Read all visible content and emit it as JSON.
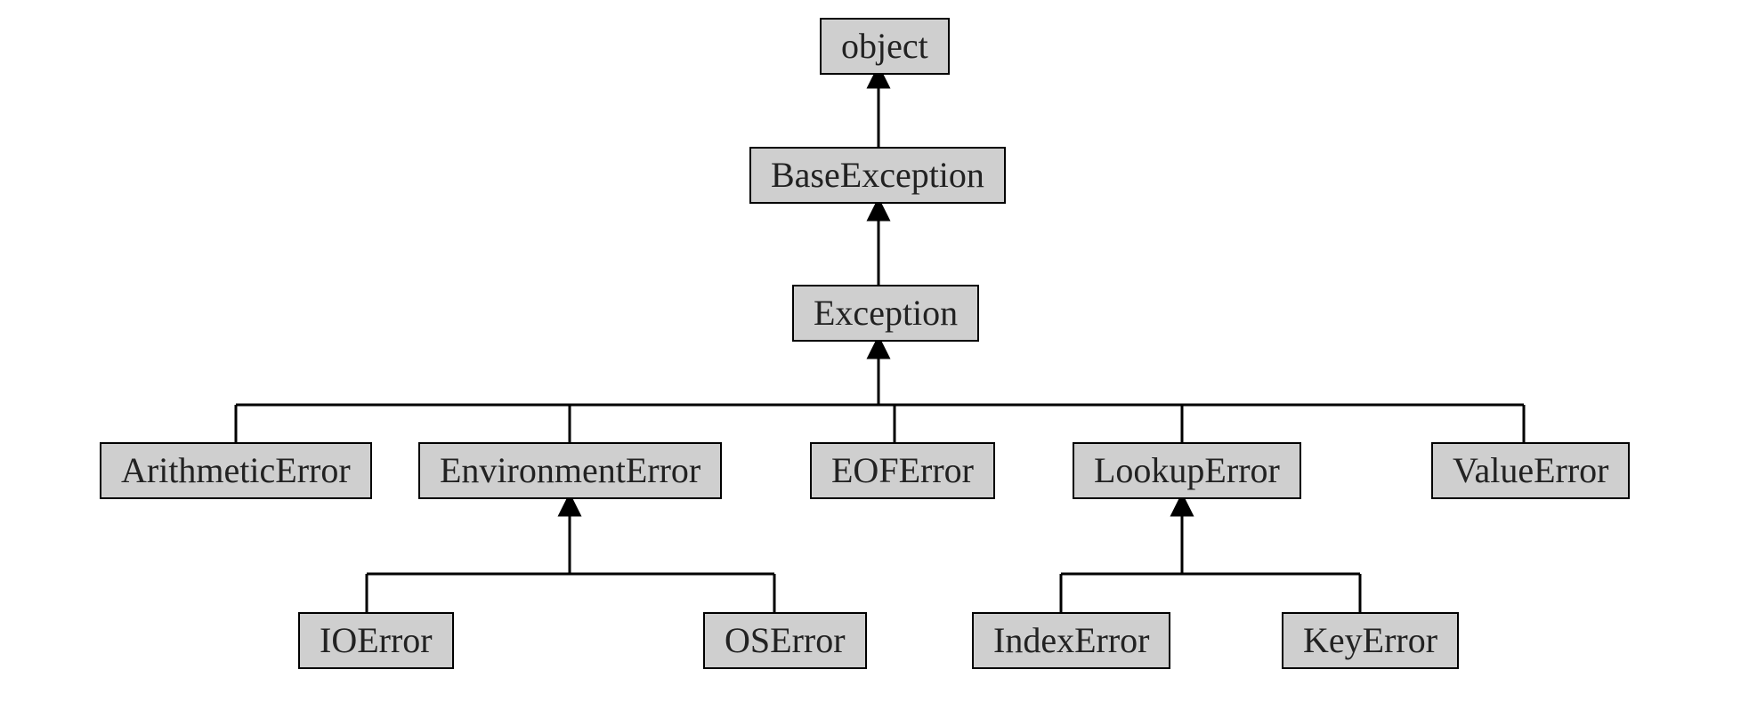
{
  "diagram": {
    "type": "class-hierarchy",
    "root": "object",
    "nodes": {
      "object": "object",
      "base_exception": "BaseException",
      "exception": "Exception",
      "arithmetic_error": "ArithmeticError",
      "environment_error": "EnvironmentError",
      "eof_error": "EOFError",
      "lookup_error": "LookupError",
      "value_error": "ValueError",
      "io_error": "IOError",
      "os_error": "OSError",
      "index_error": "IndexError",
      "key_error": "KeyError"
    },
    "edges": [
      [
        "base_exception",
        "object"
      ],
      [
        "exception",
        "base_exception"
      ],
      [
        "arithmetic_error",
        "exception"
      ],
      [
        "environment_error",
        "exception"
      ],
      [
        "eof_error",
        "exception"
      ],
      [
        "lookup_error",
        "exception"
      ],
      [
        "value_error",
        "exception"
      ],
      [
        "io_error",
        "environment_error"
      ],
      [
        "os_error",
        "environment_error"
      ],
      [
        "index_error",
        "lookup_error"
      ],
      [
        "key_error",
        "lookup_error"
      ]
    ]
  }
}
